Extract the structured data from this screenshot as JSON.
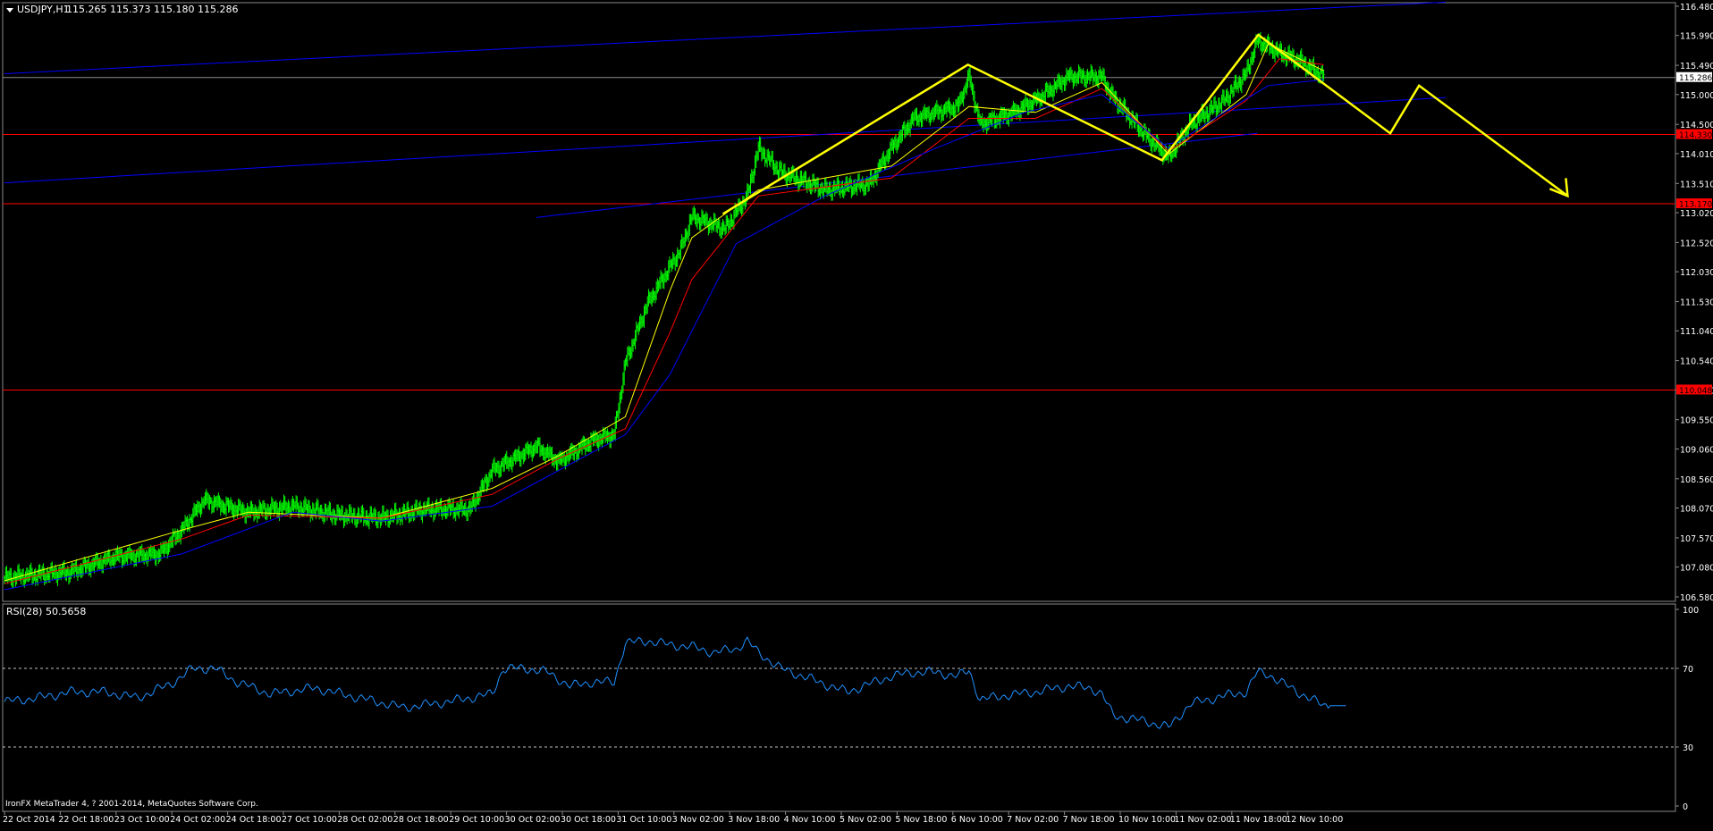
{
  "chart_header": {
    "symbol_label": "USDJPY,H1",
    "ohlc_label": "115.265 115.373 115.180 115.286"
  },
  "rsi_header": {
    "label": "RSI(28) 50.5658"
  },
  "copyright": "IronFX MetaTrader 4, ? 2001-2014, MetaQuotes Software Corp.",
  "colors": {
    "background": "#000000",
    "candle": "#00ff00",
    "ma_fast": "#ffff00",
    "ma_mid": "#ff0000",
    "ma_slow": "#0000ff",
    "level_line": "#ff0000",
    "channel_line": "#0000ff",
    "pattern_line": "#ffff00",
    "rsi_line": "#1e90ff",
    "axis_text": "#ffffff",
    "current_price_tag": "#ffffff",
    "level_tag": "#ff0000"
  },
  "chart_data": [
    {
      "type": "candlestick",
      "panel": "price",
      "symbol": "USDJPY",
      "timeframe": "H1",
      "ylim": [
        106.58,
        116.48
      ],
      "y_ticks": [
        "116.480",
        "115.990",
        "115.490",
        "115.000",
        "114.500",
        "114.010",
        "113.510",
        "113.020",
        "112.520",
        "112.030",
        "111.530",
        "111.040",
        "110.540",
        "110.050",
        "109.550",
        "109.060",
        "108.560",
        "108.070",
        "107.570",
        "107.080",
        "106.580"
      ],
      "x_ticks": [
        "22 Oct 2014",
        "22 Oct 18:00",
        "23 Oct 10:00",
        "24 Oct 02:00",
        "24 Oct 18:00",
        "27 Oct 10:00",
        "28 Oct 02:00",
        "28 Oct 18:00",
        "29 Oct 10:00",
        "30 Oct 02:00",
        "30 Oct 18:00",
        "31 Oct 10:00",
        "3 Nov 02:00",
        "3 Nov 18:00",
        "4 Nov 10:00",
        "5 Nov 02:00",
        "5 Nov 18:00",
        "6 Nov 10:00",
        "7 Nov 02:00",
        "7 Nov 18:00",
        "10 Nov 10:00",
        "11 Nov 02:00",
        "11 Nov 18:00",
        "12 Nov 10:00"
      ],
      "current_price": 115.286,
      "current_price_label": "115.286",
      "price_path": [
        [
          0,
          106.9
        ],
        [
          6,
          107.0
        ],
        [
          10,
          107.25
        ],
        [
          14,
          107.3
        ],
        [
          16,
          107.7
        ],
        [
          18,
          108.2
        ],
        [
          22,
          108.0
        ],
        [
          26,
          108.1
        ],
        [
          30,
          107.95
        ],
        [
          34,
          107.9
        ],
        [
          38,
          108.05
        ],
        [
          42,
          108.05
        ],
        [
          44,
          108.7
        ],
        [
          48,
          109.1
        ],
        [
          50,
          108.85
        ],
        [
          53,
          109.2
        ],
        [
          55,
          109.3
        ],
        [
          56,
          110.5
        ],
        [
          58,
          111.5
        ],
        [
          61,
          112.4
        ],
        [
          62,
          112.95
        ],
        [
          65,
          112.75
        ],
        [
          67,
          113.3
        ],
        [
          68,
          114.1
        ],
        [
          70,
          113.7
        ],
        [
          74,
          113.4
        ],
        [
          78,
          113.5
        ],
        [
          80,
          114.1
        ],
        [
          82,
          114.6
        ],
        [
          86,
          114.8
        ],
        [
          87,
          115.3
        ],
        [
          88,
          114.5
        ],
        [
          91,
          114.7
        ],
        [
          93,
          114.9
        ],
        [
          96,
          115.3
        ],
        [
          99,
          115.3
        ],
        [
          99.8,
          115.0
        ],
        [
          103,
          114.3
        ],
        [
          105,
          113.95
        ],
        [
          107,
          114.5
        ],
        [
          110,
          114.9
        ],
        [
          112,
          115.35
        ],
        [
          113,
          115.9
        ],
        [
          115,
          115.7
        ],
        [
          117,
          115.55
        ],
        [
          119,
          115.3
        ]
      ],
      "series": [
        {
          "name": "MA fast",
          "color": "ma_fast",
          "values": [
            [
              0,
              106.85
            ],
            [
              16,
              107.7
            ],
            [
              22,
              108.0
            ],
            [
              34,
              107.9
            ],
            [
              44,
              108.4
            ],
            [
              50,
              108.95
            ],
            [
              56,
              109.6
            ],
            [
              60,
              111.7
            ],
            [
              62,
              112.6
            ],
            [
              68,
              113.4
            ],
            [
              80,
              113.8
            ],
            [
              87,
              114.8
            ],
            [
              93,
              114.7
            ],
            [
              99,
              115.2
            ],
            [
              105,
              114.0
            ],
            [
              112,
              115.0
            ],
            [
              114,
              115.85
            ],
            [
              119,
              115.4
            ]
          ]
        },
        {
          "name": "MA mid",
          "color": "ma_mid",
          "values": [
            [
              0,
              106.8
            ],
            [
              16,
              107.55
            ],
            [
              22,
              107.95
            ],
            [
              34,
              107.9
            ],
            [
              44,
              108.3
            ],
            [
              50,
              108.9
            ],
            [
              56,
              109.4
            ],
            [
              60,
              111.0
            ],
            [
              62,
              111.9
            ],
            [
              68,
              113.3
            ],
            [
              80,
              113.6
            ],
            [
              87,
              114.6
            ],
            [
              93,
              114.6
            ],
            [
              99,
              115.1
            ],
            [
              105,
              114.05
            ],
            [
              112,
              114.9
            ],
            [
              115,
              115.6
            ],
            [
              119,
              115.5
            ]
          ]
        },
        {
          "name": "MA slow",
          "color": "ma_slow",
          "values": [
            [
              0,
              106.7
            ],
            [
              16,
              107.3
            ],
            [
              26,
              108.0
            ],
            [
              34,
              107.85
            ],
            [
              44,
              108.1
            ],
            [
              52,
              108.9
            ],
            [
              56,
              109.3
            ],
            [
              60,
              110.3
            ],
            [
              66,
              112.5
            ],
            [
              74,
              113.3
            ],
            [
              84,
              114.1
            ],
            [
              92,
              114.7
            ],
            [
              99,
              115.0
            ],
            [
              105,
              114.1
            ],
            [
              110,
              114.7
            ],
            [
              114,
              115.15
            ],
            [
              119,
              115.25
            ]
          ]
        }
      ],
      "horizontal_levels": [
        {
          "price": 115.286,
          "style": "current",
          "color": "current_price_tag"
        },
        {
          "price": 114.33,
          "label": "114.330",
          "color": "level_tag"
        },
        {
          "price": 113.17,
          "label": "113.170",
          "color": "level_tag"
        },
        {
          "price": 110.048,
          "label": "110.048",
          "color": "level_tag"
        }
      ],
      "trend_lines": [
        {
          "from": [
            0,
            113.52
          ],
          "to": [
            130,
            114.95
          ],
          "color": "channel_line"
        },
        {
          "from": [
            0,
            115.35
          ],
          "to": [
            130,
            116.55
          ],
          "color": "channel_line"
        },
        {
          "from": [
            48,
            112.94
          ],
          "to": [
            113,
            114.35
          ],
          "color": "channel_line"
        }
      ],
      "pattern_path": [
        [
          64.8,
          113.0
        ],
        [
          86.9,
          115.5
        ],
        [
          104.4,
          113.9
        ],
        [
          113.1,
          116.0
        ],
        [
          125,
          114.35
        ],
        [
          127.6,
          115.15
        ],
        [
          141,
          113.3
        ]
      ],
      "pattern_arrow_tip": [
        141,
        113.3
      ]
    },
    {
      "type": "line",
      "panel": "rsi",
      "name": "RSI(28)",
      "current_value": 50.5658,
      "ylim": [
        0,
        100
      ],
      "y_ticks": [
        "100",
        "70",
        "30",
        "0"
      ],
      "levels": [
        70,
        30
      ],
      "values": [
        [
          0,
          53
        ],
        [
          3,
          55
        ],
        [
          6,
          58
        ],
        [
          9,
          58
        ],
        [
          12,
          55
        ],
        [
          15,
          62
        ],
        [
          17,
          70
        ],
        [
          19,
          70
        ],
        [
          21,
          63
        ],
        [
          24,
          57
        ],
        [
          28,
          60
        ],
        [
          32,
          55
        ],
        [
          36,
          50
        ],
        [
          40,
          53
        ],
        [
          44,
          57
        ],
        [
          45,
          70
        ],
        [
          47,
          70
        ],
        [
          49,
          68
        ],
        [
          51,
          61
        ],
        [
          53,
          63
        ],
        [
          55,
          63
        ],
        [
          56,
          83
        ],
        [
          58,
          84
        ],
        [
          60,
          82
        ],
        [
          62,
          81
        ],
        [
          64,
          78
        ],
        [
          66,
          80
        ],
        [
          67,
          84
        ],
        [
          68,
          78
        ],
        [
          70,
          70
        ],
        [
          72,
          66
        ],
        [
          74,
          62
        ],
        [
          76,
          58
        ],
        [
          78,
          62
        ],
        [
          80,
          66
        ],
        [
          82,
          68
        ],
        [
          84,
          68
        ],
        [
          86,
          66
        ],
        [
          87,
          69
        ],
        [
          88,
          54
        ],
        [
          90,
          56
        ],
        [
          93,
          58
        ],
        [
          96,
          61
        ],
        [
          98,
          60
        ],
        [
          99,
          57
        ],
        [
          100,
          46
        ],
        [
          103,
          43
        ],
        [
          105,
          40
        ],
        [
          107,
          52
        ],
        [
          110,
          56
        ],
        [
          112,
          58
        ],
        [
          113,
          68
        ],
        [
          114,
          67
        ],
        [
          116,
          60
        ],
        [
          118,
          54
        ],
        [
          119,
          51
        ],
        [
          121,
          51
        ]
      ]
    }
  ]
}
